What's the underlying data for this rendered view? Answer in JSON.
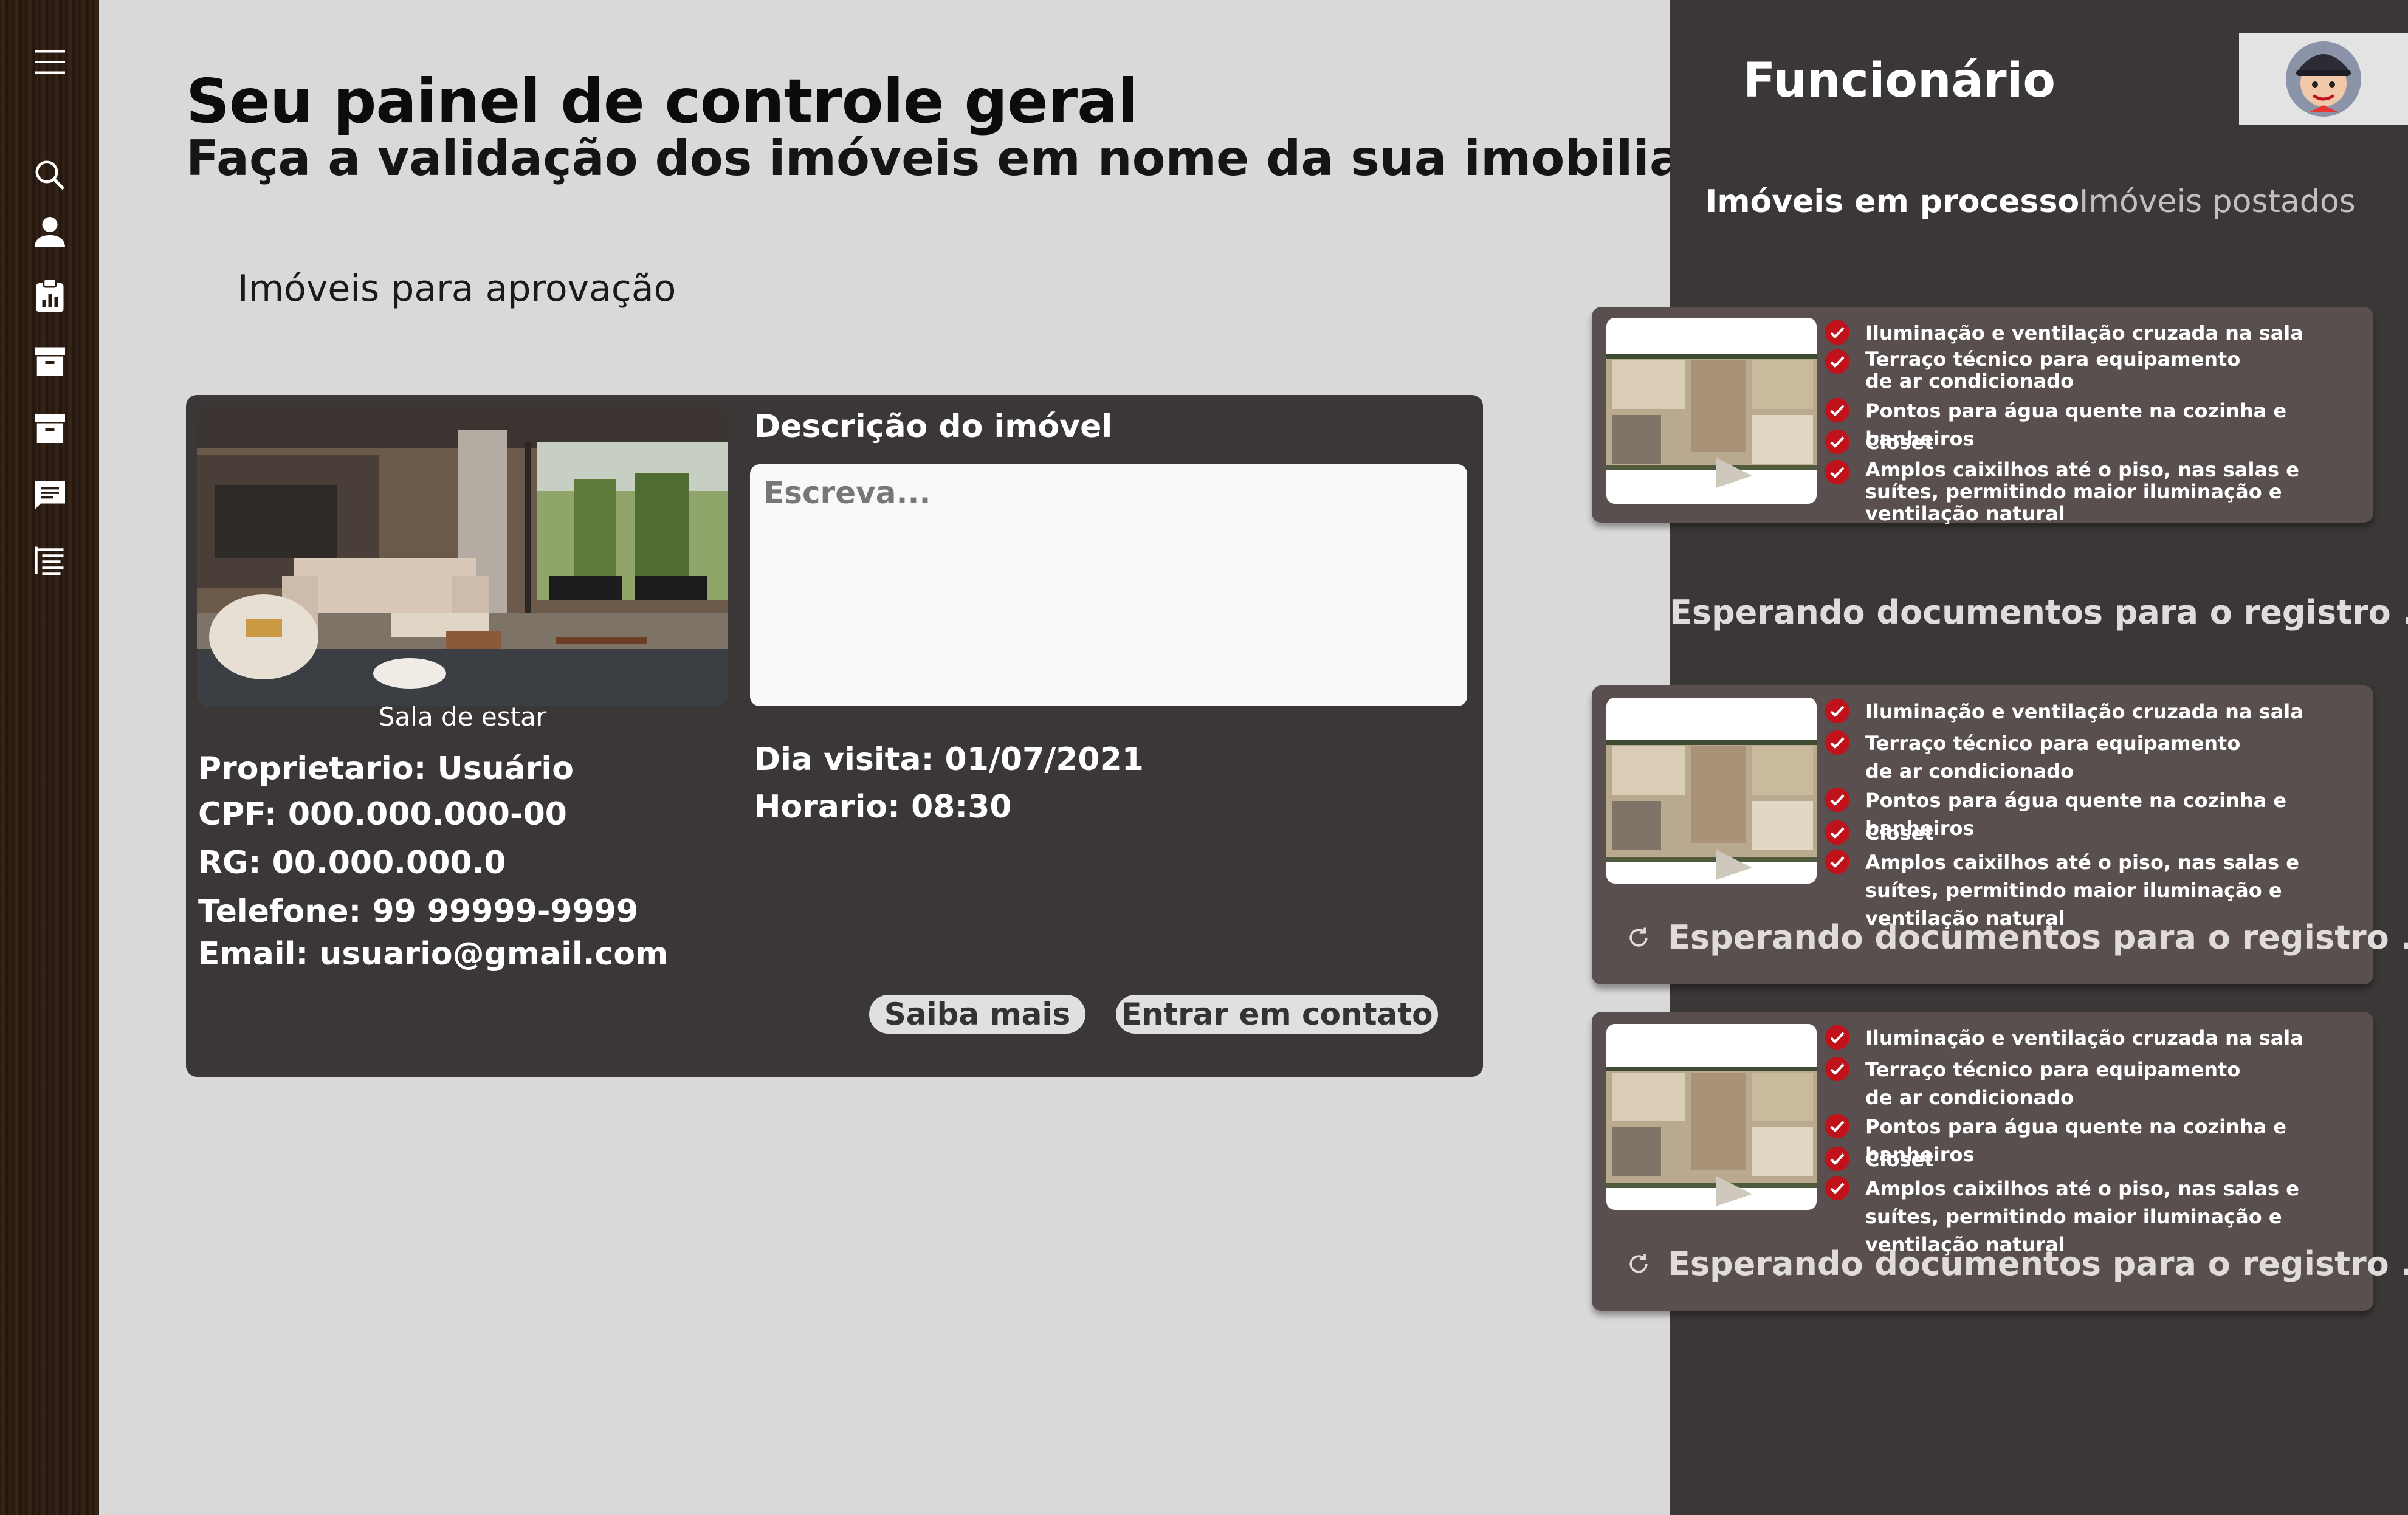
{
  "sidebar": {
    "icons": [
      "menu-icon",
      "search-icon",
      "user-icon",
      "clipboard-chart-icon",
      "archive-icon",
      "archive-icon",
      "chat-icon",
      "list-tree-icon"
    ]
  },
  "main": {
    "title": "Seu painel de controle geral",
    "subtitle": "Faça a validação dos imóveis em nome da sua imobiliaria",
    "section_title": "Imóveis para aprovação",
    "card": {
      "photo_caption": "Sala de estar",
      "description_label": "Descrição  do imóvel",
      "description_placeholder": "Escreva...",
      "owner": {
        "proprietario": "Proprietario: Usuário",
        "cpf": "CPF: 000.000.000-00",
        "rg": "RG: 00.000.000.0",
        "telefone": "Telefone: 99 99999-9999",
        "email": "Email: usuario@gmail.com"
      },
      "visit": {
        "dia": "Dia visita: 01/07/2021",
        "horario": "Horario: 08:30"
      },
      "buttons": {
        "saiba_mais": "Saiba mais",
        "contato": "Entrar em contato"
      }
    }
  },
  "right_panel": {
    "role": "Funcionário",
    "tabs": [
      "Imóveis em processo",
      "Imóveis postados"
    ],
    "features": [
      "Iluminação e ventilação cruzada na sala",
      "Terraço técnico para equipamento de ar condicionado",
      "Pontos para água quente na cozinha e banheiros",
      "Closet",
      "Amplos caixilhos até o piso, nas salas e suítes, permitindo maior iluminação e ventilação natural"
    ],
    "status_text": "Esperando documentos para o registro ...",
    "colors": {
      "check": "#c0121a",
      "panel": "#3c3737",
      "card": "#5a4f4f"
    }
  }
}
